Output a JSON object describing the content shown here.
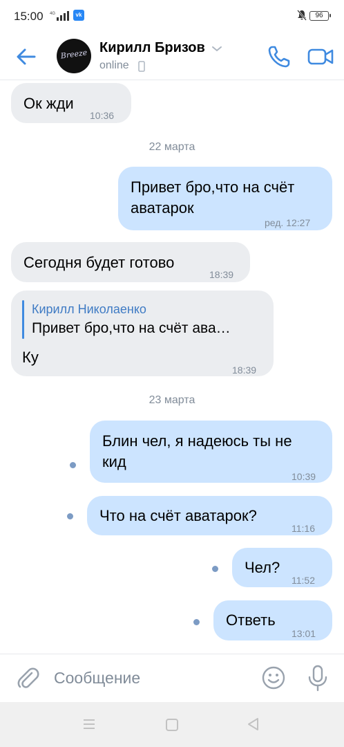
{
  "status_bar": {
    "time": "15:00",
    "network": "4G",
    "vk_badge": "vk",
    "battery": "96"
  },
  "header": {
    "contact_name": "Кирилл Бризов",
    "status": "online",
    "avatar_text": "Breeze"
  },
  "messages": {
    "m1": {
      "text": "Ок жди",
      "time": "10:36"
    },
    "date1": "22 марта",
    "m2": {
      "line1": "Привет бро,что на счёт",
      "line2": "аватарок",
      "time": "ред. 12:27"
    },
    "m3": {
      "text": "Сегодня будет готово",
      "time": "18:39"
    },
    "m4": {
      "reply_author": "Кирилл Николаенко",
      "reply_text": "Привет бро,что на счёт ава…",
      "text": "Ку",
      "time": "18:39"
    },
    "date2": "23 марта",
    "m5": {
      "line1": "Блин чел, я надеюсь ты не",
      "line2": "кид",
      "time": "10:39"
    },
    "m6": {
      "text": "Что на счёт аватарок?",
      "time": "11:16"
    },
    "m7": {
      "text": "Чел?",
      "time": "11:52"
    },
    "m8": {
      "text": "Ответь",
      "time": "13:01"
    }
  },
  "composer": {
    "placeholder": "Сообщение"
  },
  "colors": {
    "accent": "#3f8ae0",
    "outgoing_bubble": "#cce4ff",
    "incoming_bubble": "#ebedf0",
    "secondary_text": "#818c99"
  },
  "icons": [
    "back-arrow-icon",
    "phone-icon",
    "video-camera-icon",
    "paperclip-icon",
    "smile-icon",
    "microphone-icon",
    "chevron-down-icon"
  ]
}
